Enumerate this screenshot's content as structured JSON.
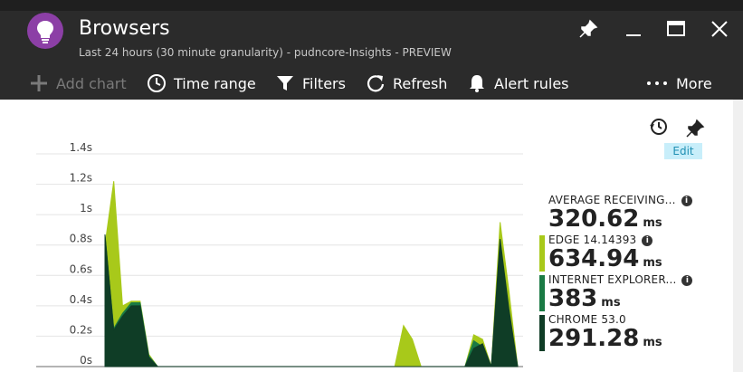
{
  "header": {
    "title": "Browsers",
    "subtitle": "Last 24 hours (30 minute granularity) - pudncore-Insights - PREVIEW"
  },
  "toolbar": {
    "add_chart": "Add chart",
    "time_range": "Time range",
    "filters": "Filters",
    "refresh": "Refresh",
    "alert_rules": "Alert rules",
    "more": "More"
  },
  "edit_label": "Edit",
  "legend": [
    {
      "name": "AVERAGE RECEIVING...",
      "value": "320.62",
      "unit": "ms",
      "color": ""
    },
    {
      "name": "EDGE 14.14393",
      "value": "634.94",
      "unit": "ms",
      "color": "#a8c91a"
    },
    {
      "name": "INTERNET EXPLORER...",
      "value": "383",
      "unit": "ms",
      "color": "#1a7a44"
    },
    {
      "name": "CHROME 53.0",
      "value": "291.28",
      "unit": "ms",
      "color": "#0f3d26"
    }
  ],
  "chart_data": {
    "type": "area",
    "title": "",
    "xlabel": "",
    "ylabel": "",
    "ylim": [
      0,
      1.4
    ],
    "y_ticks": [
      "0s",
      "0.2s",
      "0.4s",
      "0.6s",
      "0.8s",
      "1s",
      "1.2s",
      "1.4s"
    ],
    "grid": true,
    "x": [
      0,
      1,
      2,
      3,
      4,
      5,
      6,
      7,
      8,
      9,
      10,
      11,
      12,
      13,
      14,
      15,
      16,
      17,
      18,
      19,
      20,
      21,
      22,
      23,
      24,
      25,
      26,
      27,
      28,
      29,
      30,
      31,
      32,
      33,
      34,
      35,
      36,
      37,
      38,
      39,
      40,
      41,
      42,
      43,
      44,
      45,
      46,
      47
    ],
    "series": [
      {
        "name": "EDGE 14.14393",
        "color": "#a8c91a",
        "values": [
          0.8,
          1.22,
          0.4,
          0.43,
          0.43,
          0.08,
          0,
          0,
          0,
          0,
          0,
          0,
          0,
          0,
          0,
          0,
          0,
          0,
          0,
          0,
          0,
          0,
          0,
          0,
          0,
          0,
          0,
          0,
          0,
          0,
          0,
          0,
          0,
          0,
          0.27,
          0.18,
          0,
          0,
          0,
          0,
          0,
          0,
          0.21,
          0.18,
          0,
          0.95,
          0.5,
          0
        ]
      },
      {
        "name": "INTERNET EXPLORER...",
        "color": "#1a7a44",
        "values": [
          0.86,
          0.25,
          0.35,
          0.42,
          0.42,
          0.07,
          0,
          0,
          0,
          0,
          0,
          0,
          0,
          0,
          0,
          0,
          0,
          0,
          0,
          0,
          0,
          0,
          0,
          0,
          0,
          0,
          0,
          0,
          0,
          0,
          0,
          0,
          0,
          0,
          0,
          0,
          0,
          0,
          0,
          0,
          0,
          0,
          0.17,
          0.13,
          0,
          0.8,
          0.35,
          0
        ]
      },
      {
        "name": "CHROME 53.0",
        "color": "#0f3d26",
        "values": [
          0.87,
          0.24,
          0.33,
          0.4,
          0.4,
          0.06,
          0,
          0,
          0,
          0,
          0,
          0,
          0,
          0,
          0,
          0,
          0,
          0,
          0,
          0,
          0,
          0,
          0,
          0,
          0,
          0,
          0,
          0,
          0,
          0,
          0,
          0,
          0,
          0,
          0,
          0,
          0,
          0,
          0,
          0,
          0,
          0,
          0.12,
          0.15,
          0,
          0.84,
          0.38,
          0
        ]
      }
    ]
  }
}
